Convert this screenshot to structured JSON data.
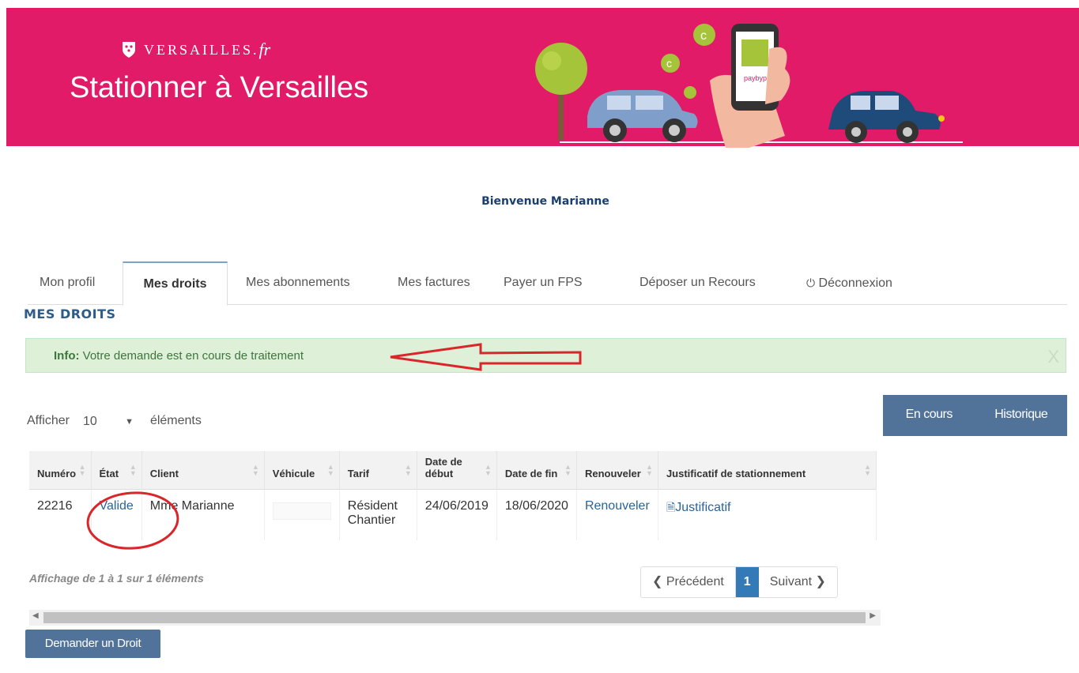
{
  "header": {
    "brand": "VERSAILLES.",
    "brand_suffix": "fr",
    "title": "Stationner à Versailles",
    "illustration_label": "paybyphone",
    "colors": {
      "banner": "#e21b68"
    }
  },
  "welcome": "Bienvenue Marianne",
  "tabs": [
    {
      "label": "Mon profil"
    },
    {
      "label": "Mes droits",
      "active": true
    },
    {
      "label": "Mes abonnements"
    },
    {
      "label": "Mes factures"
    },
    {
      "label": "Payer un FPS"
    },
    {
      "label": "Déposer un Recours"
    },
    {
      "label": "Déconnexion",
      "icon": "power-icon"
    }
  ],
  "section_title": "MES DROITS",
  "alert": {
    "label": "Info:",
    "message": "Votre demande est en cours de traitement",
    "close": "X"
  },
  "length": {
    "before": "Afficher",
    "value": "10",
    "after": "éléments"
  },
  "segments": {
    "current": "En cours",
    "history": "Historique"
  },
  "table": {
    "headers": [
      "Numéro",
      "État",
      "Client",
      "Véhicule",
      "Tarif",
      "Date de début",
      "Date de fin",
      "Renouveler",
      "Justificatif de stationnement"
    ],
    "rows": [
      {
        "numero": "22216",
        "etat": "Valide",
        "client": "Mme Marianne",
        "vehicule": "",
        "tarif": "Résident Chantier",
        "debut": "24/06/2019",
        "fin": "18/06/2020",
        "renouveler": "Renouveler",
        "justificatif": "Justificatif"
      }
    ]
  },
  "info_text": "Affichage de 1 à 1 sur 1 éléments",
  "pagination": {
    "prev": "Précédent",
    "current": "1",
    "next": "Suivant"
  },
  "request_button": "Demander un Droit"
}
